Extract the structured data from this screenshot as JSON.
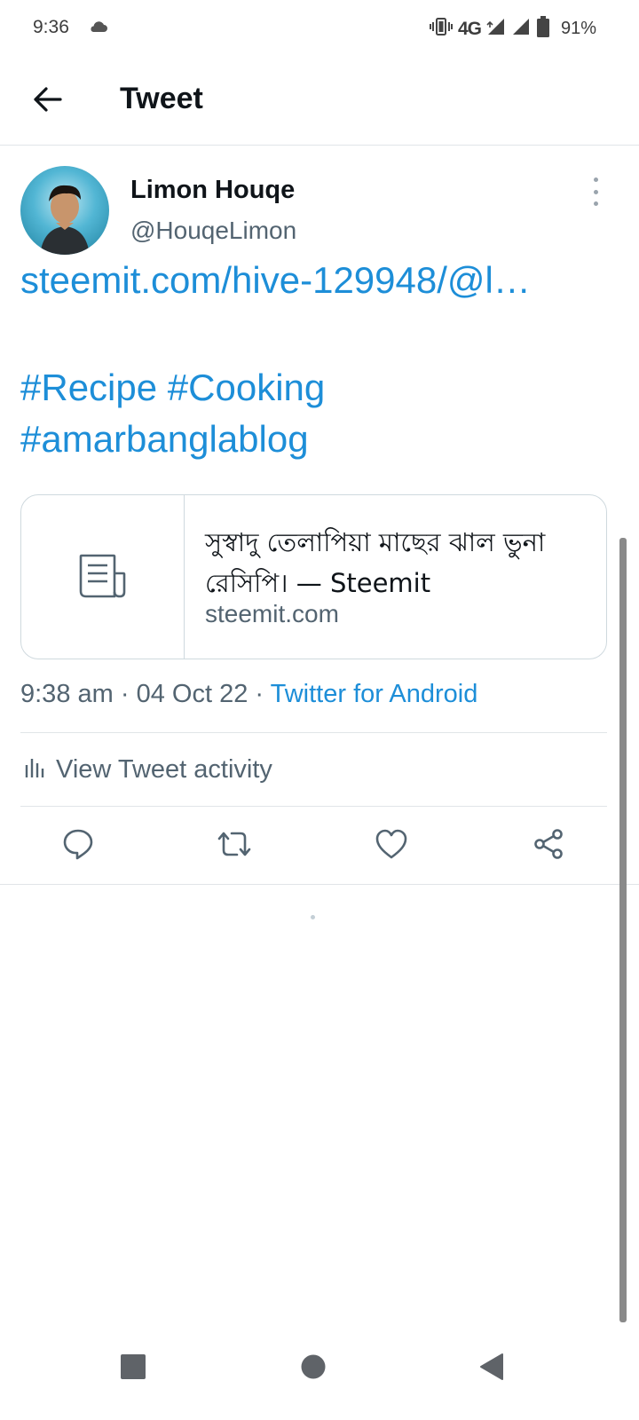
{
  "status_bar": {
    "time": "9:36",
    "network": "4G",
    "battery": "91%",
    "icons": [
      "cloud-icon",
      "vibrate-icon",
      "signal-icon",
      "signal-icon",
      "battery-icon"
    ]
  },
  "header": {
    "title": "Tweet",
    "back_icon": "arrow-left-icon"
  },
  "tweet": {
    "display_name": "Limon Houqe",
    "handle": "@HouqeLimon",
    "link_text": "steemit.com/hive-129948/@l…",
    "hashtags": [
      "#Recipe",
      "#Cooking",
      "#amarbanglablog"
    ],
    "card": {
      "title": "সুস্বাদু তেলাপিয়া মাছের ঝাল ভুনা রেসিপি। — Steemit",
      "domain": "steemit.com",
      "icon": "article-icon"
    },
    "meta": {
      "time": "9:38 am",
      "separator": "·",
      "date": "04 Oct 22",
      "source": "Twitter for Android"
    },
    "activity_label": "View Tweet activity",
    "actions": [
      "reply-icon",
      "retweet-icon",
      "like-icon",
      "share-icon"
    ]
  },
  "colors": {
    "link": "#1d8ed8",
    "text": "#0f1419",
    "secondary": "#536471",
    "divider": "#e1e5e8"
  },
  "nav_bar": {
    "buttons": [
      "recents-square-icon",
      "home-circle-icon",
      "back-triangle-icon"
    ]
  }
}
